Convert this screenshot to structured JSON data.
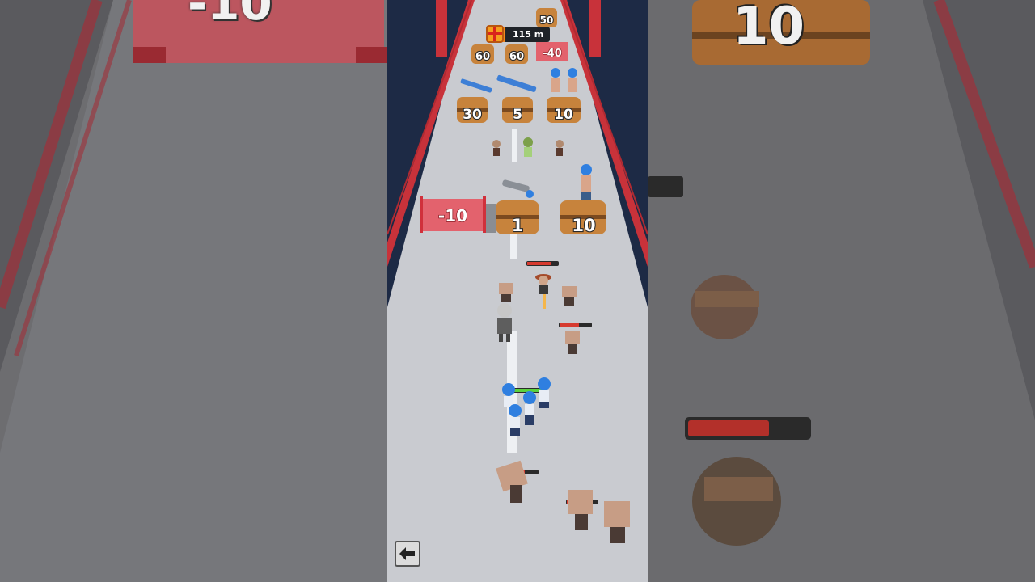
{
  "hud": {
    "distance": "115 m",
    "gift_icon": "gift-icon"
  },
  "gates": {
    "top_far": "-40",
    "main": "-10"
  },
  "barrels": {
    "far_row": [
      "50"
    ],
    "row_60": [
      "60",
      "60"
    ],
    "row_upper": [
      "30",
      "5",
      "10"
    ],
    "row_lower": [
      "1",
      "10"
    ]
  },
  "side_panels": {
    "left_top_text": "-10",
    "right_top_text": "10"
  },
  "controls": {
    "back_icon": "back-arrow-icon"
  },
  "colors": {
    "road": "#c9cbd0",
    "bridge_red": "#c8323a",
    "barrel": "#c7833c",
    "gate": "#e8505c",
    "player_blue": "#2f7fe0",
    "health_green": "#5ad13d",
    "enemy_health_red": "#d63a2f"
  }
}
